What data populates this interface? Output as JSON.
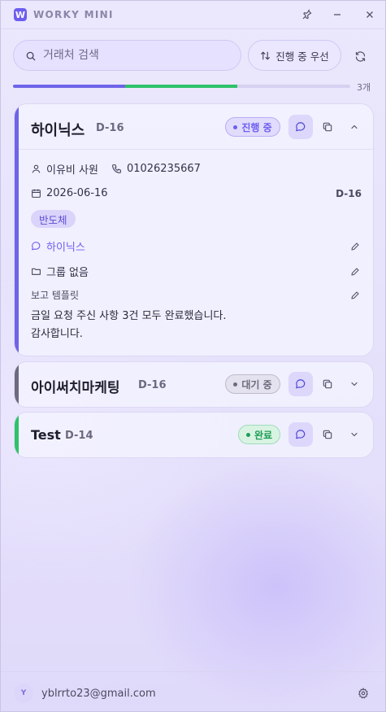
{
  "app": {
    "logo_letter": "W",
    "title": "WORKY MINI"
  },
  "search": {
    "placeholder": "거래처 검색"
  },
  "sort": {
    "label": "진행 중 우선"
  },
  "progress": {
    "count_label": "3개",
    "segments": [
      {
        "fraction": 0.333,
        "color": "#6e64e8"
      },
      {
        "fraction": 0.333,
        "color": "#2ec26a"
      }
    ]
  },
  "cards": [
    {
      "title": "하이닉스",
      "dday": "D-16",
      "status": "진행 중",
      "status_color": "#6d5ef0",
      "accent": "#6e64e8",
      "expanded": true,
      "contact_name": "이유비 사원",
      "phone": "01026235667",
      "date": "2026-06-16",
      "date_dday": "D-16",
      "tag": "반도체",
      "chat_name": "하이닉스",
      "group": "그룹 없음",
      "template_label": "보고 템플릿",
      "note": "금일 요청 주신 사항 3건 모두 완료했습니다.\n감사합니다."
    },
    {
      "title": "아이써치마케팅",
      "dday": "D-16",
      "status": "대기 중",
      "status_color": "#6c6a7e",
      "accent": "#6c6a7e",
      "expanded": false
    },
    {
      "title": "Test",
      "dday": "D-14",
      "status": "완료",
      "status_color": "#1f9d55",
      "accent": "#2ec26a",
      "expanded": false
    }
  ],
  "footer": {
    "avatar_letter": "Y",
    "email": "yblrrto23@gmail.com"
  },
  "icons": {
    "pin": "pin-icon",
    "minimize": "minimize-icon",
    "close": "close-icon",
    "search": "search-icon",
    "sort": "sort-arrows-icon",
    "refresh": "refresh-icon",
    "chat": "chat-bubble-icon",
    "copy": "copy-icon",
    "chevron_up": "chevron-up-icon",
    "chevron_down": "chevron-down-icon",
    "person": "person-icon",
    "phone": "phone-icon",
    "calendar": "calendar-icon",
    "folder": "folder-icon",
    "pencil": "pencil-icon",
    "settings": "gear-icon"
  }
}
